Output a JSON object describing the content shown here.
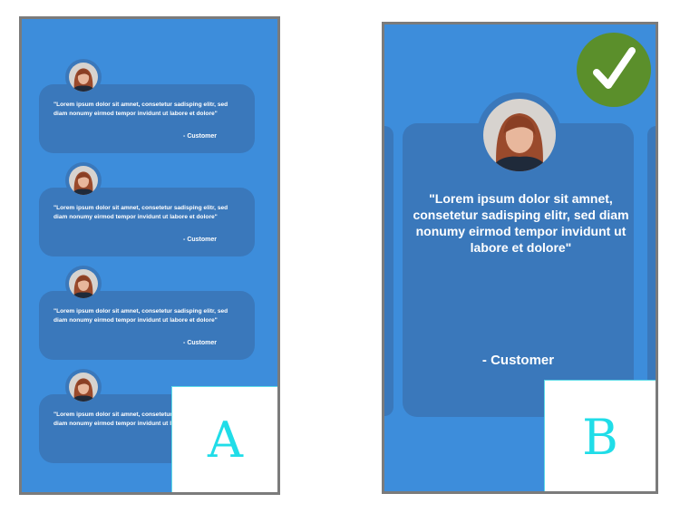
{
  "quote": "\"Lorem ipsum dolor sit amnet, consetetur sadisping elitr, sed diam nonumy eirmod tempor invidunt ut labore et dolore\"",
  "customer": "- Customer",
  "labels": {
    "a": "A",
    "b": "B"
  },
  "colors": {
    "background": "#3d8ddb",
    "card": "#3a78bb",
    "check": "#5b8f2b",
    "label": "#20dde8"
  },
  "icons": {
    "avatar": "woman-portrait-icon",
    "check": "checkmark-icon"
  }
}
